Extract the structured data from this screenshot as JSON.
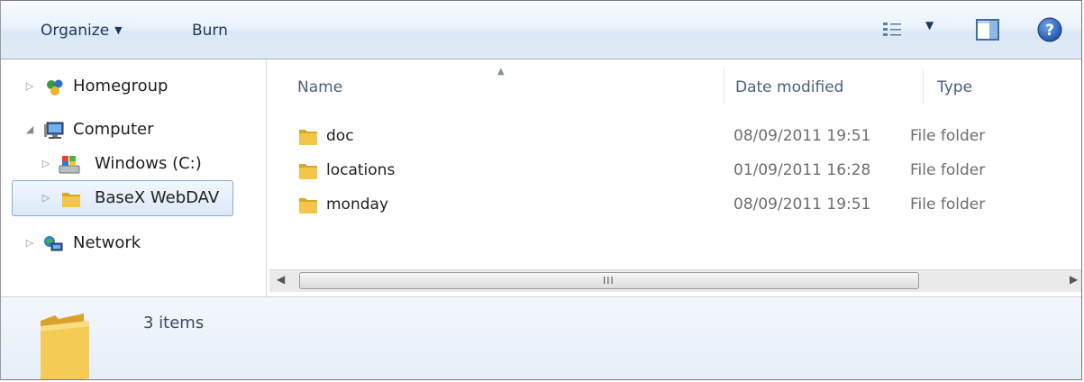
{
  "toolbar": {
    "organize_label": "Organize",
    "burn_label": "Burn",
    "icons": [
      "change-view-icon",
      "preview-pane-icon",
      "help-icon"
    ]
  },
  "nav": {
    "items": [
      {
        "label": "Homegroup",
        "icon": "homegroup-icon",
        "expander": "collapsed"
      },
      {
        "label": "Computer",
        "icon": "computer-icon",
        "expander": "expanded"
      },
      {
        "label": "Windows (C:)",
        "icon": "drive-icon",
        "expander": "collapsed"
      },
      {
        "label": "BaseX WebDAV",
        "icon": "folder-icon",
        "expander": "collapsed",
        "selected": true
      },
      {
        "label": "Network",
        "icon": "network-icon",
        "expander": "collapsed"
      }
    ]
  },
  "columns": {
    "name": "Name",
    "date": "Date modified",
    "type": "Type"
  },
  "files": [
    {
      "name": "doc",
      "date": "08/09/2011 19:51",
      "type": "File folder"
    },
    {
      "name": "locations",
      "date": "01/09/2011 16:28",
      "type": "File folder"
    },
    {
      "name": "monday",
      "date": "08/09/2011 19:51",
      "type": "File folder"
    }
  ],
  "details": {
    "count_text": "3 items"
  },
  "colors": {
    "toolbar_text": "#1e395b",
    "selection_border": "#84acdd",
    "folder_yellow": "#f3c64a"
  }
}
